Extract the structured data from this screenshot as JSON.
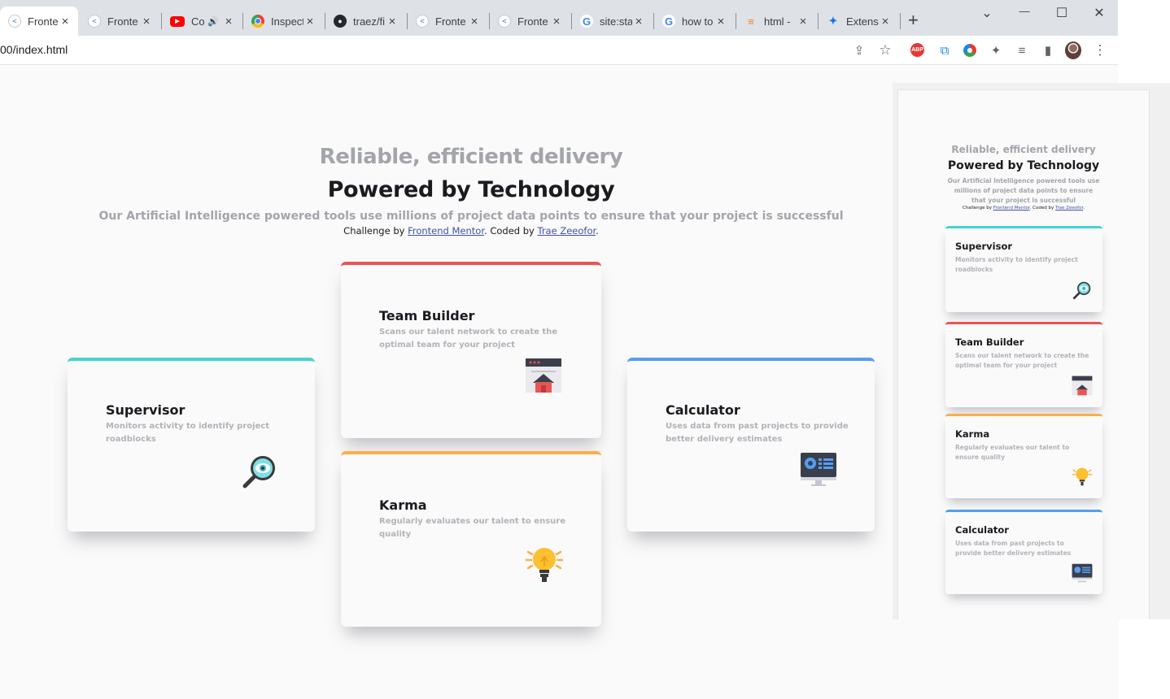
{
  "browser": {
    "tabs": [
      {
        "title": "Fronte",
        "icon": "frontend-mentor-icon",
        "active": true
      },
      {
        "title": "Fronte",
        "icon": "frontend-mentor-icon"
      },
      {
        "title": "Co",
        "icon": "youtube-icon",
        "audio": "🔊"
      },
      {
        "title": "Inspect",
        "icon": "chrome-icon"
      },
      {
        "title": "traez/fi",
        "icon": "github-icon"
      },
      {
        "title": "Fronte",
        "icon": "frontend-mentor-icon"
      },
      {
        "title": "Fronte",
        "icon": "frontend-mentor-icon"
      },
      {
        "title": "site:sta",
        "icon": "google-icon"
      },
      {
        "title": "how to",
        "icon": "google-icon"
      },
      {
        "title": "html -",
        "icon": "stackoverflow-icon"
      },
      {
        "title": "Extens",
        "icon": "extension-puzzle-icon"
      }
    ],
    "tab_close": "×",
    "new_tab": "+",
    "window_controls": {
      "collapse": "⌄",
      "minimize": "—",
      "maximize": "☐",
      "close": "✕"
    },
    "url": "00/index.html",
    "toolbar_icons": [
      "share-icon",
      "star-icon",
      "adblock-icon",
      "ext-copy-icon",
      "ext-circle-icon",
      "puzzle-icon",
      "media-icon",
      "sidepanel-icon",
      "profile-avatar",
      "menu-icon"
    ],
    "toolbar_glyphs": {
      "share": "⇪",
      "star": "☆",
      "abp": "ABP",
      "copy": "⧉",
      "puzzle": "✦",
      "media": "≡",
      "sidepanel": "▮",
      "menu": "⋮"
    }
  },
  "main": {
    "heading_light": "Reliable, efficient delivery",
    "heading_strong": "Powered by Technology",
    "description": "Our Artificial Intelligence powered tools use millions of project data points to ensure that your project is successful",
    "attribution_prefix": "Challenge by ",
    "attribution_link1": "Frontend Mentor",
    "attribution_middle": ". Coded by ",
    "attribution_link2": "Trae Zeeofor",
    "attribution_suffix": ".",
    "cards": {
      "supervisor": {
        "title": "Supervisor",
        "desc": "Monitors activity to identify project roadblocks",
        "accent": "#44d3d2",
        "icon": "supervisor-magnifier-icon"
      },
      "team_builder": {
        "title": "Team Builder",
        "desc": "Scans our talent network to create the optimal team for your project",
        "accent": "#ea5454",
        "icon": "team-builder-icon"
      },
      "karma": {
        "title": "Karma",
        "desc": "Regularly evaluates our talent to ensure quality",
        "accent": "#fcae4a",
        "icon": "karma-lightbulb-icon"
      },
      "calculator": {
        "title": "Calculator",
        "desc": "Uses data from past projects to provide better delivery estimates",
        "accent": "#549ef2",
        "icon": "calculator-monitor-icon"
      }
    }
  },
  "side_preview": {
    "heading_light": "Reliable, efficient delivery",
    "heading_strong": "Powered by Technology",
    "description": "Our Artificial Intelligence powered tools use millions of project data points to ensure that your project is successful",
    "attribution_prefix": "Challenge by ",
    "attribution_link1": "Frontend Mentor",
    "attribution_middle": ". Coded by ",
    "attribution_link2": "Trae Zeeofor",
    "attribution_suffix": ".",
    "cards": [
      {
        "title": "Supervisor",
        "desc": "Monitors activity to identify project roadblocks",
        "accent": "#44d3d2"
      },
      {
        "title": "Team Builder",
        "desc": "Scans our talent network to create the optimal team for your project",
        "accent": "#ea5454"
      },
      {
        "title": "Karma",
        "desc": "Regularly evaluates our talent to ensure quality",
        "accent": "#fcae4a"
      },
      {
        "title": "Calculator",
        "desc": "Uses data from past projects to provide better delivery estimates",
        "accent": "#549ef2"
      }
    ]
  }
}
